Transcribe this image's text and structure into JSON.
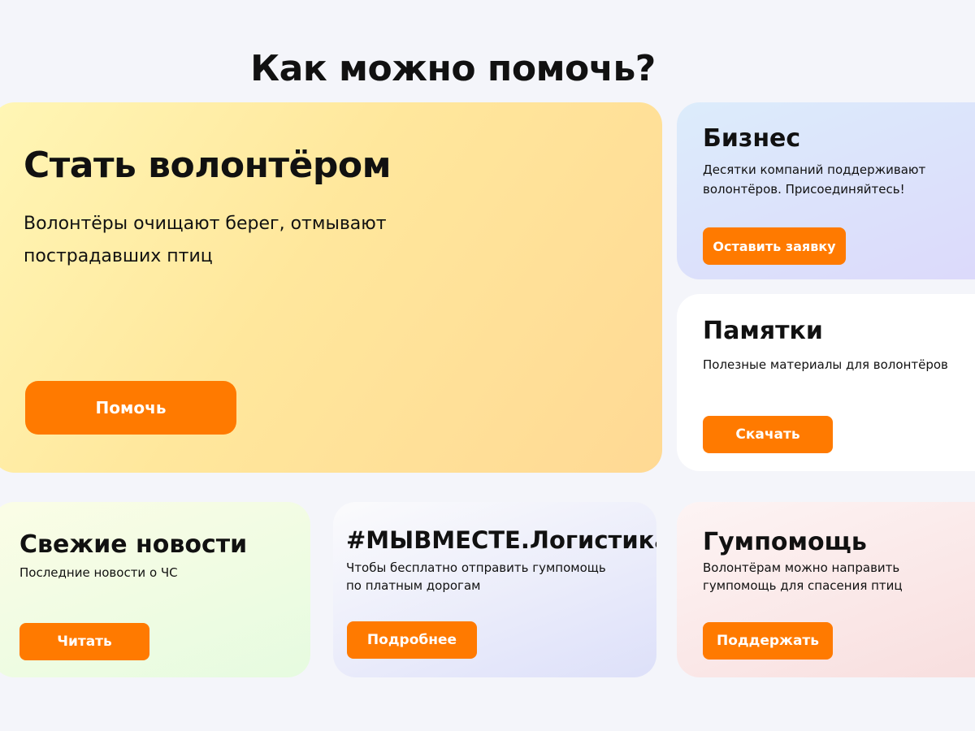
{
  "page": {
    "title": "Как можно помочь?"
  },
  "volunteer": {
    "title": "Стать волонтёром",
    "text": "Волонтёры очищают берег, отмывают пострадавших птиц",
    "button": "Помочь"
  },
  "business": {
    "title": "Бизнес",
    "text": "Десятки компаний поддерживают волонтёров. Присоединяйтесь!",
    "button": "Оставить заявку"
  },
  "memos": {
    "title": "Памятки",
    "text": "Полезные материалы для волонтёров",
    "button": "Скачать"
  },
  "news": {
    "title": "Свежие новости",
    "text": "Последние новости о ЧС",
    "button": "Читать"
  },
  "logistics": {
    "title": "#МЫВМЕСТЕ.Логистика",
    "text": "Чтобы бесплатно отправить гумпомощь по платным дорогам",
    "button": "Подробнее"
  },
  "aid": {
    "title": "Гумпомощь",
    "text": "Волонтёрам можно направить гумпомощь для спасения птиц",
    "button": "Поддержать"
  },
  "colors": {
    "accent": "#ff7a00",
    "background": "#f4f5fa"
  }
}
